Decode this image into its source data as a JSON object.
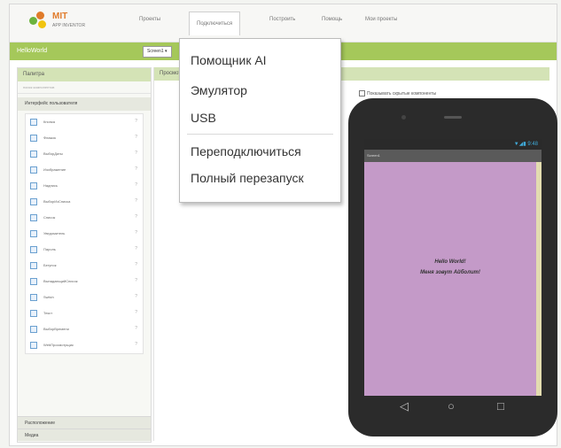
{
  "top_menu": [
    "Проекты",
    "Подключиться",
    "Построить",
    "Помощь",
    "Мои проекты"
  ],
  "dropdown": [
    "Помощник AI",
    "Эмулятор",
    "USB",
    "Переподключиться",
    "Полный перезапуск"
  ],
  "project_bar": {
    "title": "HelloWorld",
    "screen_selector": "Screen1 ▾"
  },
  "palette": {
    "title": "Палитра",
    "search_placeholder": "поиск компонентов",
    "category": "Интерфейс пользователя",
    "items": [
      "Кнопка",
      "Флажок",
      "ВыборДаты",
      "Изображение",
      "Надпись",
      "ВыборИзСписка",
      "Список",
      "Уведомитель",
      "Пароль",
      "Бегунок",
      "ВыпадающийСписок",
      "Switch",
      "Текст",
      "ВыборВремени",
      "WebПросмотрщик"
    ],
    "help_mark": "?",
    "footer": [
      "Расположение",
      "Медиа"
    ]
  },
  "viewer": {
    "title": "Просмотр",
    "hidden_checkbox": "Показывать скрытые компоненты"
  },
  "phone": {
    "status_text": "▼◢▮ 9:48",
    "screen_title": "Screen1",
    "greeting_line1": "Hello World!",
    "greeting_line2": "Меня зовут Айболит!",
    "nav": [
      "◁",
      "○",
      "□"
    ]
  },
  "colors": {
    "accent_green": "#a5c85a",
    "phone_screen": "#c49ac8",
    "logo_orange": "#e07b2a"
  }
}
